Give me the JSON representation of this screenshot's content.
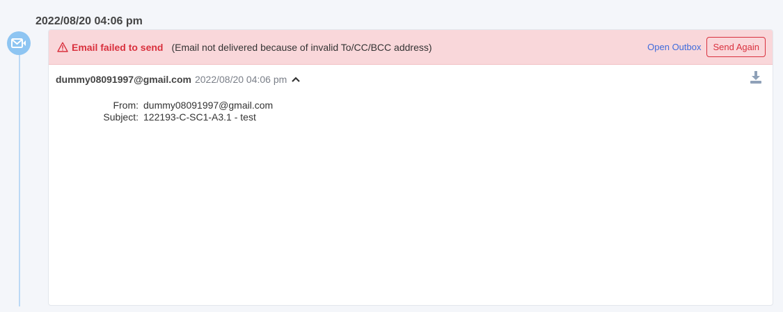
{
  "timeline": {
    "date": "2022/08/20 04:06 pm"
  },
  "error": {
    "title": "Email failed to send",
    "description": "(Email not delivered because of invalid To/CC/BCC address)",
    "open_outbox": "Open Outbox",
    "send_again": "Send Again"
  },
  "email": {
    "sender": "dummy08091997@gmail.com",
    "date": "2022/08/20 04:06 pm",
    "from_label": "From:",
    "from_value": "dummy08091997@gmail.com",
    "subject_label": "Subject:",
    "subject_value": "122193-C-SC1-A3.1 - test"
  },
  "icons": {
    "timeline": "email-icon",
    "warning": "warning-icon",
    "expand": "chevron-up-icon",
    "download": "download-icon"
  },
  "colors": {
    "error_bg": "#f9d7da",
    "error_text": "#d9303d",
    "link": "#3f6bdb",
    "timeline_dot": "#8ec5f2"
  }
}
